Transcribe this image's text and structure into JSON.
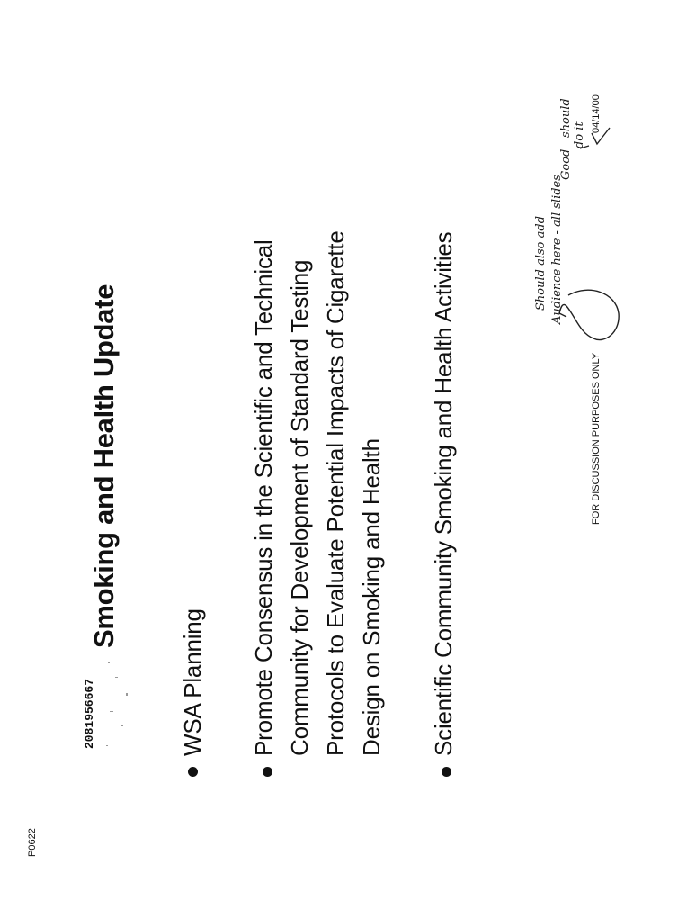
{
  "slide": {
    "title": "Smoking and Health Update",
    "bullets": [
      {
        "lines": [
          "WSA Planning"
        ]
      },
      {
        "lines": [
          "Promote Consensus in the Scientific and Technical",
          "Community for Development of Standard Testing",
          "Protocols to Evaluate Potential Impacts of Cigarette",
          "Design on Smoking and Health"
        ]
      },
      {
        "lines": [
          "Scientific Community Smoking and Health Activities"
        ]
      }
    ]
  },
  "footer": {
    "slide_code": "P0622",
    "document_number": "2081956667",
    "disclaimer": "FOR DISCUSSION PURPOSES ONLY",
    "date": "04/14/00"
  },
  "handwriting": {
    "note_line1": "Should also add",
    "note_line2": "Audience here - all slides",
    "note_line3": "Good - should",
    "note_line4": "do it"
  }
}
